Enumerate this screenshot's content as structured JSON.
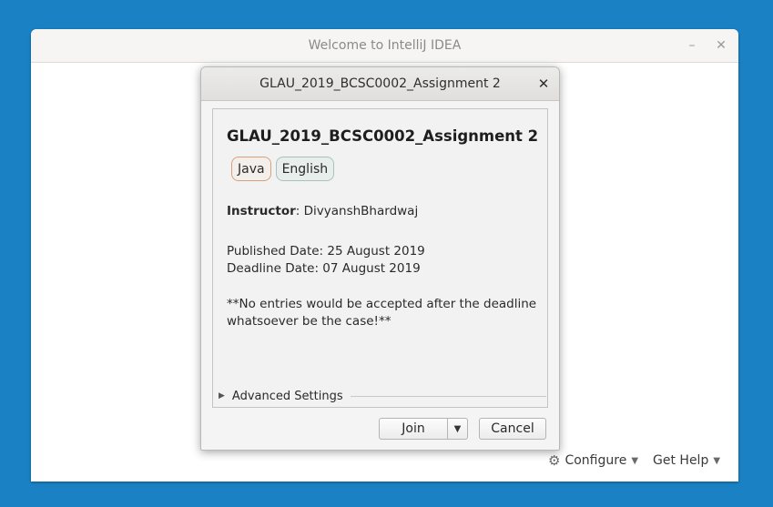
{
  "main_window": {
    "title": "Welcome to IntelliJ IDEA",
    "minimize_glyph": "–",
    "close_glyph": "✕",
    "configure_label": "Configure",
    "get_help_label": "Get Help"
  },
  "dialog": {
    "title": "GLAU_2019_BCSC0002_Assignment 2",
    "close_glyph": "✕",
    "course_title": "GLAU_2019_BCSC0002_Assignment 2",
    "tags": [
      "Java",
      "English"
    ],
    "instructor_label": "Instructor",
    "instructor_name": ": DivyanshBhardwaj",
    "published": "Published Date: 25 August 2019",
    "deadline": "Deadline Date: 07 August 2019",
    "description": "**No entries would be accepted after the deadline whatsoever be the case!**",
    "advanced_settings": "Advanced Settings",
    "join_label": "Join",
    "cancel_label": "Cancel"
  },
  "icons": {
    "configure": "gear-icon",
    "dropdown": "chevron-down-icon",
    "advanced": "triangle-right-icon"
  }
}
